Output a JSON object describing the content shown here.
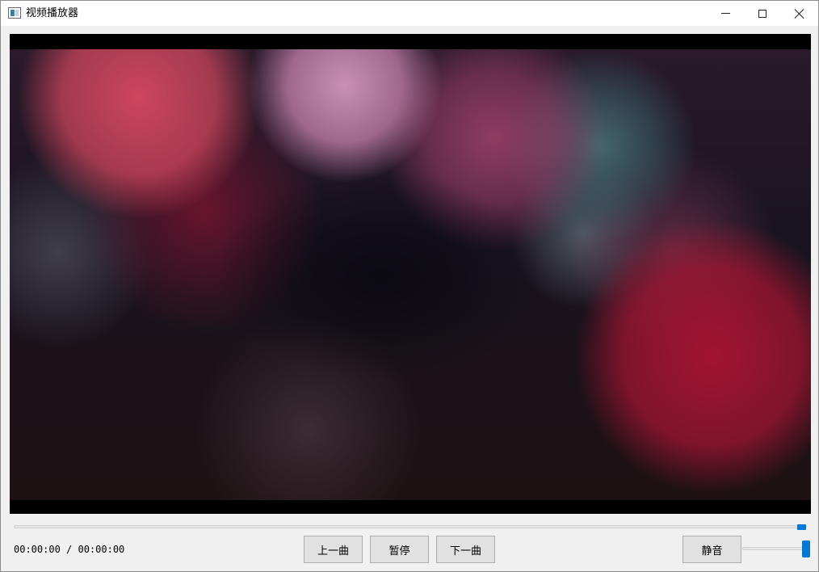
{
  "window": {
    "title": "视频播放器"
  },
  "player": {
    "time_display": "00:00:00 / 00:00:00",
    "position_fraction": 1.0,
    "volume_fraction": 1.0
  },
  "controls": {
    "prev_label": "上一曲",
    "pause_label": "暂停",
    "next_label": "下一曲",
    "mute_label": "静音"
  },
  "colors": {
    "accent": "#0078d7",
    "button_bg": "#e1e1e1",
    "window_bg": "#f0f0f0"
  },
  "icons": {
    "app": "video-player-icon",
    "minimize": "minimize-icon",
    "maximize": "maximize-icon",
    "close": "close-icon"
  }
}
